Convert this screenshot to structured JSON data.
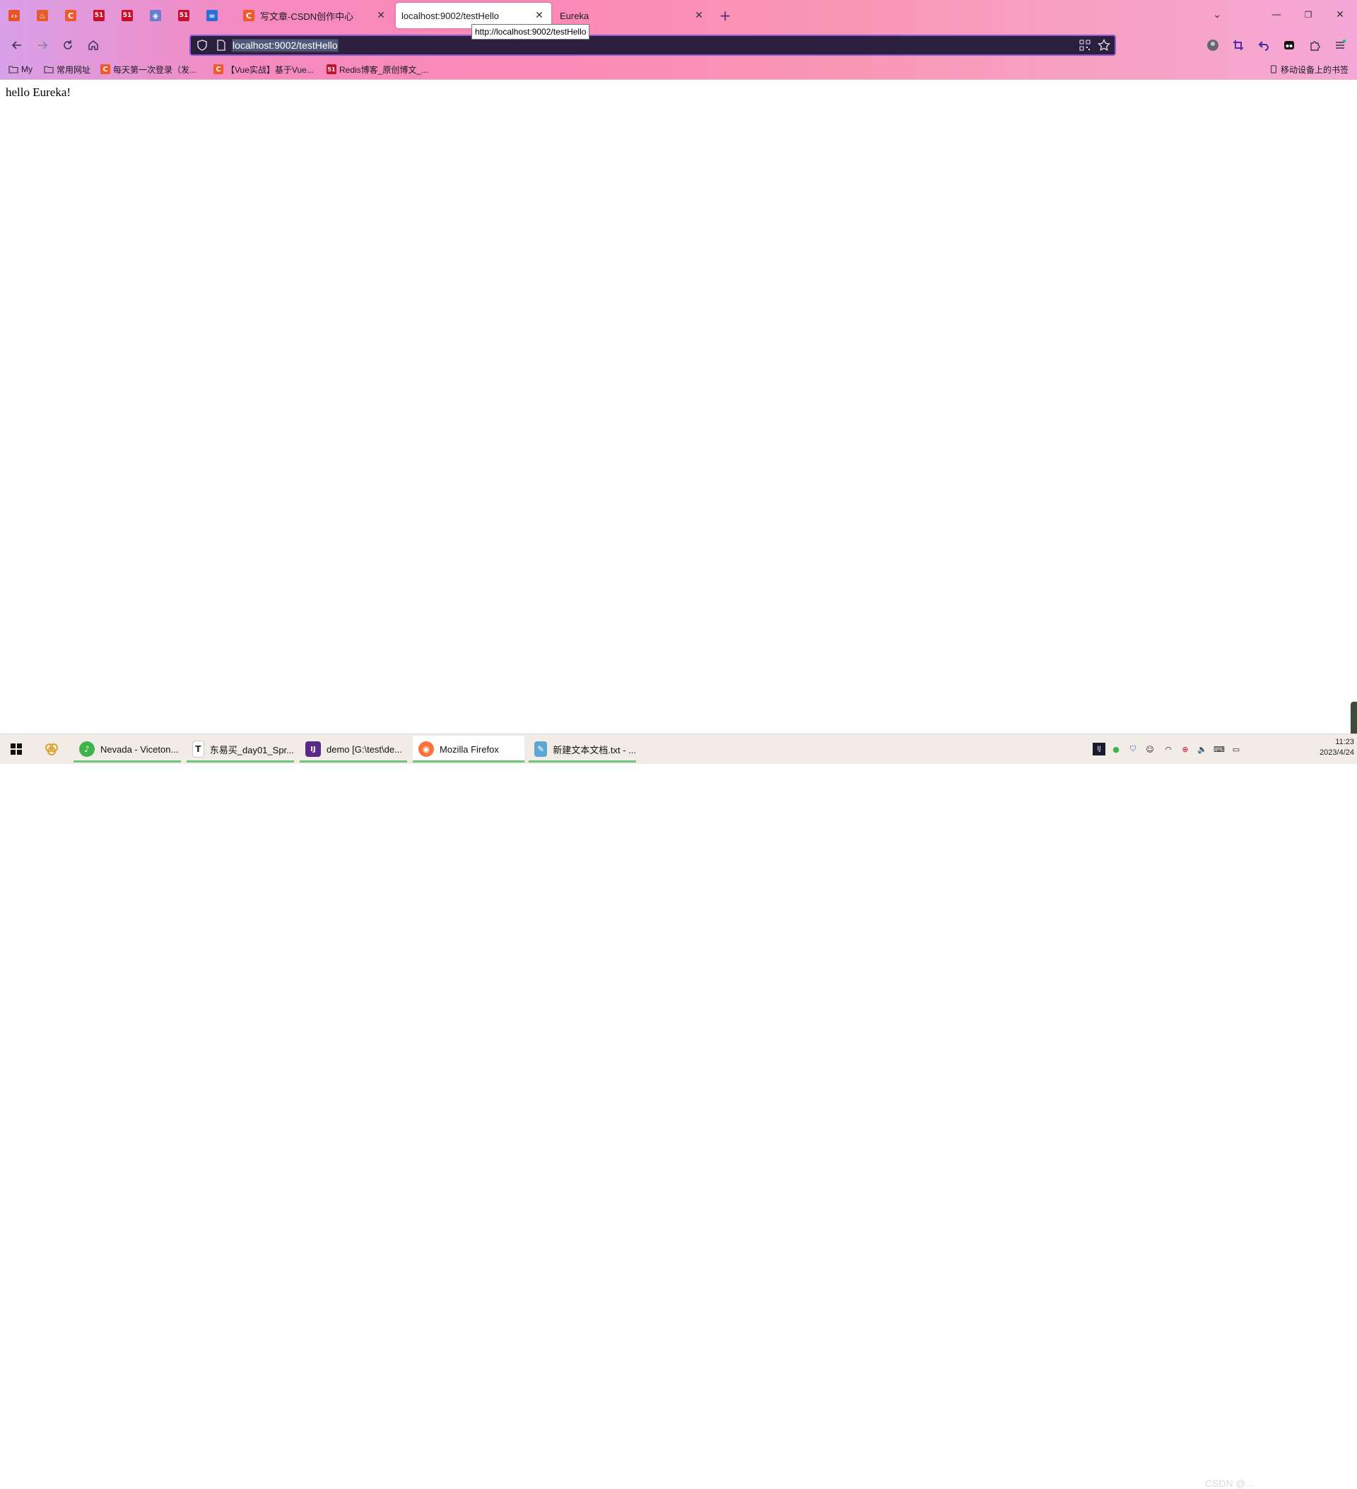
{
  "browser": {
    "pinned_tabs": [
      {
        "icon": "code-bracket-icon",
        "color": "#e8542a",
        "glyph": "‹›"
      },
      {
        "icon": "flame-icon",
        "color": "#e85a2a",
        "glyph": "♨"
      },
      {
        "icon": "csdn-c-icon",
        "color": "#f05a2a",
        "glyph": "C"
      },
      {
        "icon": "51cto-icon",
        "color": "#c8102e",
        "glyph": "51"
      },
      {
        "icon": "51cto-icon",
        "color": "#c8102e",
        "glyph": "51"
      },
      {
        "icon": "layers-icon",
        "color": "#6a7bd0",
        "glyph": "◈"
      },
      {
        "icon": "51cto-icon",
        "color": "#c8102e",
        "glyph": "51"
      },
      {
        "icon": "glasses-icon",
        "color": "#2b6fd6",
        "glyph": "∞"
      }
    ],
    "tabs": [
      {
        "title": "写文章-CSDN创作中心",
        "favicon": "C",
        "favicon_color": "#f05a2a",
        "active": false,
        "close": "✕"
      },
      {
        "title": "localhost:9002/testHello",
        "favicon": "",
        "favicon_color": "",
        "active": true,
        "close": "✕"
      },
      {
        "title": "Eureka",
        "favicon": "",
        "favicon_color": "",
        "active": false,
        "close": "✕"
      }
    ],
    "new_tab_glyph": "+",
    "tab_list_glyph": "⌄",
    "window_controls": {
      "minimize": "—",
      "restore": "❐",
      "close": "✕"
    },
    "tooltip": "http://localhost:9002/testHello",
    "address_bar": {
      "url": "localhost:9002/testHello"
    },
    "bookmarks": [
      {
        "label": "My",
        "icon": "folder-icon"
      },
      {
        "label": "常用网址",
        "icon": "folder-icon"
      },
      {
        "label": "每天第一次登录（发...",
        "icon": "csdn-c-icon",
        "glyph": "C",
        "color": "#f05a2a"
      },
      {
        "label": "【Vue实战】基于Vue...",
        "icon": "csdn-c-icon",
        "glyph": "C",
        "color": "#f05a2a"
      },
      {
        "label": "Redis博客_原创博文_...",
        "icon": "51cto-icon",
        "glyph": "51",
        "color": "#c8102e"
      }
    ],
    "mobile_bookmarks": "移动设备上的书签"
  },
  "page": {
    "text": "hello Eureka!"
  },
  "taskbar": {
    "apps": [
      {
        "label": "Nevada - Viceton...",
        "icon": "music-player-icon",
        "color": "#3cb44b",
        "glyph": "♪"
      },
      {
        "label": "东易买_day01_Spr...",
        "icon": "typora-icon",
        "color": "#ffffff",
        "glyph": "T"
      },
      {
        "label": "demo [G:\\test\\de...",
        "icon": "intellij-idea-icon",
        "color": "#5b2a86",
        "glyph": "IJ"
      },
      {
        "label": "Mozilla Firefox",
        "icon": "firefox-icon",
        "color": "#ff7139",
        "glyph": "◉"
      },
      {
        "label": "新建文本文档.txt - ...",
        "icon": "notepad-icon",
        "color": "#5aa7d6",
        "glyph": "✎"
      }
    ],
    "clock": {
      "time": "11:23",
      "date": "2023/4/24"
    },
    "watermark": "CSDN @..."
  }
}
